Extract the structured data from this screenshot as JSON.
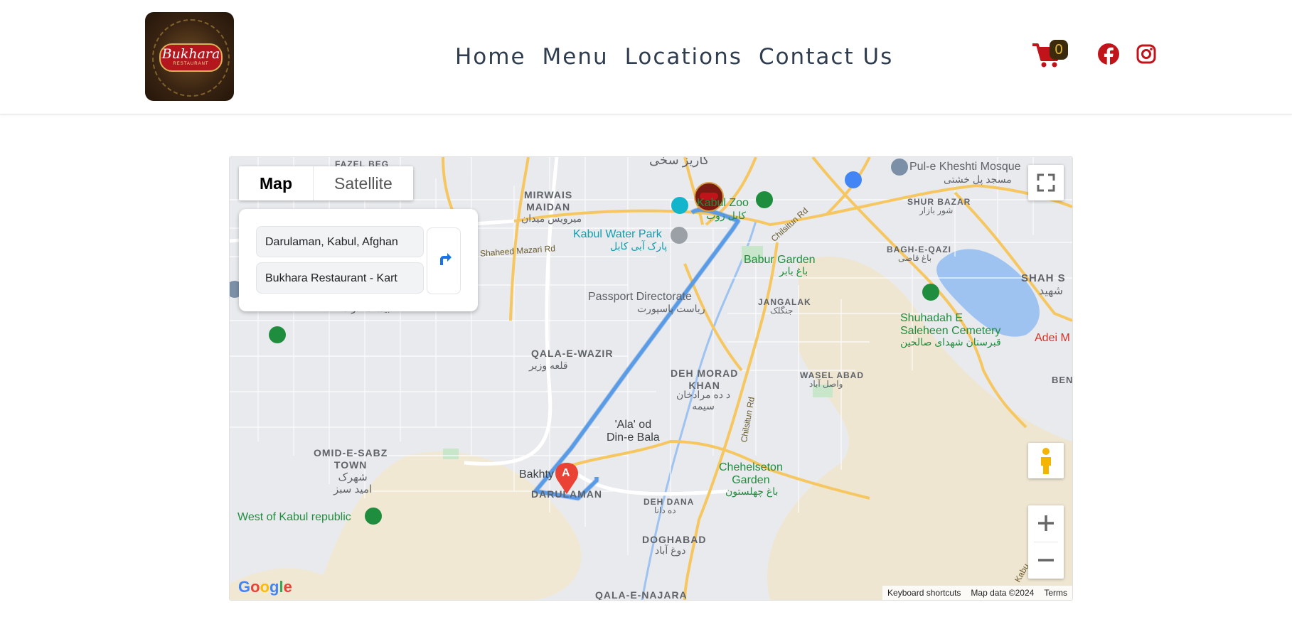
{
  "header": {
    "logo": {
      "brand": "Bukhara",
      "sub": "RESTAURANT"
    },
    "nav": [
      {
        "label": "Home"
      },
      {
        "label": "Menu"
      },
      {
        "label": "Locations"
      },
      {
        "label": "Contact Us"
      }
    ],
    "cart_count": "0",
    "social": [
      "facebook-icon",
      "instagram-icon"
    ],
    "colors": {
      "icon_red": "#c0141a",
      "nav_text": "#2f3d4e"
    }
  },
  "map": {
    "map_type": {
      "map": "Map",
      "satellite": "Satellite"
    },
    "directions": {
      "origin": "Darulaman, Kabul, Afghan",
      "destination": "Bukhara Restaurant - Kart"
    },
    "marker_a": "A",
    "labels": {
      "fazel_beg": "FAZEL BEG",
      "kariz_top": "کاریز سخی",
      "mirwais": "MIRWAIS\nMAIDAN",
      "mirwais_urdu": "میرویس میدان",
      "kabul_zoo": "Kabul Zoo",
      "kabul_zoo_urdu": "کابل زوب",
      "kabul_water_park": "Kabul Water Park",
      "water_park_urdu": "پارک آبی کابل",
      "shaheed_mazari": "Shaheed Mazari Rd",
      "chilsitun_rd_top": "Chilsitun Rd",
      "babur_garden": "Babur Garden",
      "babur_urdu": "باغ بابر",
      "passport": "Passport Directorate",
      "passport_urdu": "ریاست پاسپورت",
      "pul_e_kheshti": "Pul-e Kheshti Mosque",
      "pul_urdu": "مسجد پل خشتی",
      "shur_bazar": "SHUR BAZAR",
      "shur_urdu": "شور بازار",
      "bagh_e_qazi": "BAGH-E-QAZI",
      "bagh_urdu": "باغ قاضی",
      "shah_s": "SHAH S",
      "shah_urdu": "شهید",
      "jangalak": "JANGALAK",
      "jangalak_urdu": "جنگلک",
      "shuhadah": "Shuhadah E\nSaleheen Cemetery",
      "shuhadah_urdu": "قبرستان شهدای صالحین",
      "adei": "Adei M",
      "qala_e_wazir": "QALA-E-WAZIR",
      "qala_urdu": "قلعه وزیر",
      "deh_morad": "DEH MORAD\nKHAN",
      "deh_morad_urdu": "د ده مرادخان\nسیمه",
      "wasel_abad": "WASEL ABAD",
      "wasel_urdu": "واصل آباد",
      "ben": "BEN",
      "ala_od_din": "'Ala' od\nDin-e Bala",
      "chilsitun_rd": "Chilsitun Rd",
      "omid": "OMID-E-SABZ\nTOWN",
      "omid_urdu": "شهرک\nامید سبز",
      "bakhty": "Bakhty",
      "darulaman": "DARULAMAN",
      "chehelseton": "Chehelseton\nGarden",
      "chehelseton_urdu": "باغ چهلستون",
      "deh_dana": "DEH DANA",
      "deh_dana_urdu": "ده دانا",
      "west_kabul": "West of Kabul republic",
      "doghabad": "DOGHABAD",
      "doghabad_urdu": "دوغ آباد",
      "qala_e_najara": "QALA-E-NAJARA",
      "kabu": "Kabu",
      "hidden_urdu": "بیست عزت"
    },
    "attribution": {
      "keyboard": "Keyboard shortcuts",
      "map_data": "Map data ©2024",
      "terms": "Terms"
    },
    "google": "Google",
    "colors": {
      "route": "#5a9be6",
      "water": "#9ec3f0",
      "park_green": "#1e8e3e",
      "marker_red": "#ea4335",
      "terrain": "#efe6d2",
      "highway": "#f6c761"
    }
  }
}
